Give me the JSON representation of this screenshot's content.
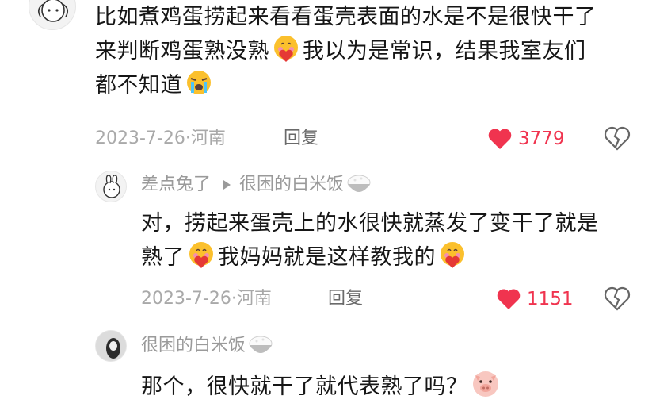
{
  "comments": [
    {
      "text_lines": [
        "比如煮鸡蛋捞起来看看蛋壳表面的水是不是很快干了",
        "来判断鸡蛋熟没熟",
        "我以为是常识，结果我室友们",
        "都不知道"
      ],
      "date": "2023-7-26",
      "location": "河南",
      "reply_label": "回复",
      "likes": "3779",
      "emojis": [
        "heart-hug-emoji",
        "crying-emoji"
      ]
    },
    {
      "username": "差点兔了",
      "reply_to": "很困的白米饭",
      "text_lines": [
        "对，捞起来蛋壳上的水很快就蒸发了变干了就是",
        "熟了",
        "我妈妈就是这样教我的"
      ],
      "date": "2023-7-26",
      "location": "河南",
      "reply_label": "回复",
      "likes": "1151",
      "emojis": [
        "heart-hug-emoji",
        "rice-bowl-emoji"
      ]
    },
    {
      "username": "很困的白米饭",
      "text_lines": [
        "那个，很快就干了就代表熟了吗？"
      ],
      "emojis": [
        "rice-bowl-emoji",
        "pig-face-emoji"
      ]
    }
  ],
  "colors": {
    "like": "#f0344f",
    "meta": "#a9a9a9",
    "text": "#161616"
  }
}
